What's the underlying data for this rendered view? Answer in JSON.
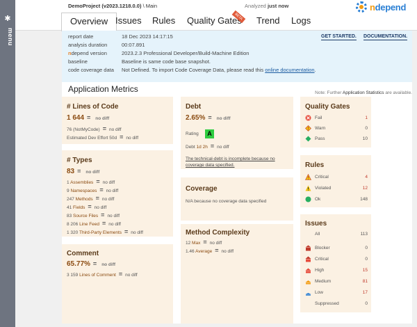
{
  "rail": {
    "icon": "expand-icon",
    "label": "menu"
  },
  "header": {
    "project_name": "DemoProject (v2023.1218.0.0)",
    "project_suffix": " \\ Main",
    "analyzed_prefix": "Analyzed ",
    "analyzed_value": "just now",
    "logo_n": "n",
    "logo_rest": "depend"
  },
  "nav": {
    "tabs": [
      "Overview",
      "Issues",
      "Rules",
      "Quality Gates",
      "Trend",
      "Logs"
    ],
    "active": "Overview",
    "beta_badge": "BETA"
  },
  "info": {
    "rows": [
      {
        "label": "report date",
        "value": "18 Dec 2023 14:17:15"
      },
      {
        "label": "analysis duration",
        "value": "00:07.891"
      },
      {
        "label_brand": "n",
        "label": "depend version",
        "value": "2023.2.3   Professional Developer/Build-Machine Edition"
      },
      {
        "label": "baseline",
        "value": "Baseline is same code base snapshot."
      },
      {
        "label": "code coverage data",
        "value": "Not Defined. To import Code Coverage Data, please read this ",
        "link": "online documentation",
        "value_end": "."
      }
    ],
    "buttons": [
      "GET STARTED.",
      "DOCUMENTATION."
    ]
  },
  "main": {
    "title": "Application Metrics",
    "note_prefix": "Note: Further ",
    "note_link": "Application Statistics",
    "note_suffix": " are available."
  },
  "loc": {
    "title": "# Lines of Code",
    "value": "1 644",
    "nodiff": "no diff",
    "lines": [
      {
        "text": "76  (NotMyCode)",
        "nodiff": "no diff"
      },
      {
        "text": "Estimated Dev Effort  50d",
        "nodiff": "no diff"
      }
    ]
  },
  "types": {
    "title": "# Types",
    "value": "83",
    "nodiff": "no diff",
    "lines": [
      {
        "n": "1",
        "label": "Assemblies",
        "nodiff": "no diff"
      },
      {
        "n": "9",
        "label": "Namespaces",
        "nodiff": "no diff"
      },
      {
        "n": "247",
        "label": "Methods",
        "nodiff": "no diff"
      },
      {
        "n": "41",
        "label": "Fields",
        "nodiff": "no diff"
      },
      {
        "n": "83",
        "label": "Source Files",
        "nodiff": "no diff"
      },
      {
        "n": "8 206",
        "label": "Line Feed",
        "nodiff": "no diff"
      },
      {
        "n": "1 320",
        "label": "Third-Party Elements",
        "nodiff": "no diff"
      }
    ]
  },
  "comment": {
    "title": "Comment",
    "value": "65.77%",
    "nodiff": "no diff",
    "line_n": "3 159",
    "line_label": "Lines of Comment",
    "line_nodiff": "no diff"
  },
  "debt": {
    "title": "Debt",
    "value": "2.65%",
    "nodiff": "no diff",
    "rating_label": "Rating",
    "rating": "A",
    "debt_label": "Debt",
    "debt_value": "1d 2h",
    "debt_nodiff": "no diff",
    "warning": "The technical-debt is incomplete because no coverage data specified."
  },
  "coverage": {
    "title": "Coverage",
    "text": "N/A because no coverage data specified"
  },
  "complexity": {
    "title": "Method Complexity",
    "lines": [
      {
        "n": "12",
        "label": "Max",
        "nodiff": "no diff"
      },
      {
        "n": "1.46",
        "label": "Average",
        "nodiff": "no diff"
      }
    ]
  },
  "quality_gates": {
    "title": "Quality Gates",
    "rows": [
      {
        "label": "Fail",
        "value": "1",
        "icon": "fail-icon"
      },
      {
        "label": "Warn",
        "value": "0",
        "icon": "warn-icon"
      },
      {
        "label": "Pass",
        "value": "10",
        "icon": "pass-icon"
      }
    ]
  },
  "rules": {
    "title": "Rules",
    "rows": [
      {
        "label": "Critical",
        "value": "4",
        "icon": "critical-icon"
      },
      {
        "label": "Violated",
        "value": "12",
        "icon": "violated-icon"
      },
      {
        "label": "Ok",
        "value": "148",
        "icon": "ok-icon"
      }
    ]
  },
  "issues": {
    "title": "Issues",
    "rows": [
      {
        "label": "All",
        "value": "113"
      },
      {
        "label": "Blocker",
        "value": "0",
        "icon": "blocker-icon"
      },
      {
        "label": "Critical",
        "value": "0",
        "icon": "critical-severity-icon"
      },
      {
        "label": "High",
        "value": "15",
        "icon": "high-severity-icon"
      },
      {
        "label": "Medium",
        "value": "81",
        "icon": "medium-severity-icon"
      },
      {
        "label": "Low",
        "value": "17",
        "icon": "low-severity-icon"
      },
      {
        "label": "Suppressed",
        "value": "0"
      }
    ]
  },
  "colors": {
    "accent": "#2a7fd4",
    "brand_orange": "#e67e22",
    "card_bg": "#fbf1e3",
    "info_bg": "#e5f3fb"
  }
}
